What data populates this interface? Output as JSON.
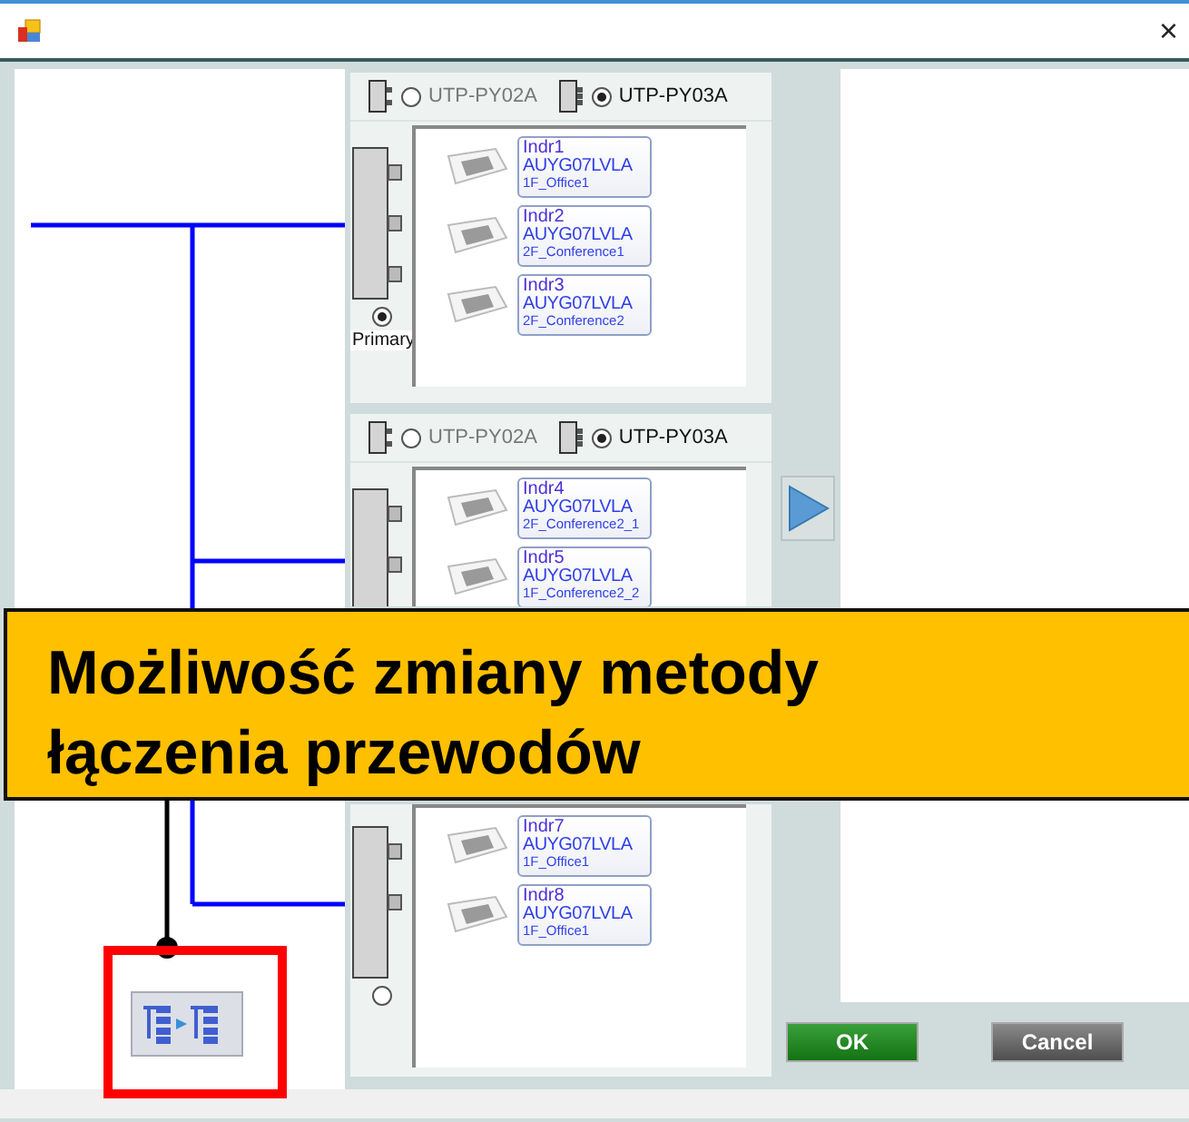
{
  "window": {
    "close": "×"
  },
  "groups": [
    {
      "options": [
        {
          "label": "UTP-PY02A",
          "selected": false
        },
        {
          "label": "UTP-PY03A",
          "selected": true
        }
      ],
      "units": [
        {
          "name": "Indr1",
          "model": "AUYG07LVLA",
          "location": "1F_Office1"
        },
        {
          "name": "Indr2",
          "model": "AUYG07LVLA",
          "location": "2F_Conference1"
        },
        {
          "name": "Indr3",
          "model": "AUYG07LVLA",
          "location": "2F_Conference2"
        }
      ],
      "primary": {
        "label": "Primary",
        "selected": true
      }
    },
    {
      "options": [
        {
          "label": "UTP-PY02A",
          "selected": false
        },
        {
          "label": "UTP-PY03A",
          "selected": true
        }
      ],
      "units": [
        {
          "name": "Indr4",
          "model": "AUYG07LVLA",
          "location": "2F_Conference2_1"
        },
        {
          "name": "Indr5",
          "model": "AUYG07LVLA",
          "location": "1F_Conference2_2"
        }
      ]
    },
    {
      "units": [
        {
          "name": "Indr7",
          "model": "AUYG07LVLA",
          "location": "1F_Office1"
        },
        {
          "name": "Indr8",
          "model": "AUYG07LVLA",
          "location": "1F_Office1"
        }
      ],
      "primary": {
        "selected": false
      }
    }
  ],
  "buttons": [
    {
      "label": "OK",
      "kind": "ok"
    },
    {
      "label": "Cancel",
      "kind": "cancel"
    }
  ],
  "callout": {
    "text": "Możliwość zmiany metody łączenia przewodów"
  }
}
